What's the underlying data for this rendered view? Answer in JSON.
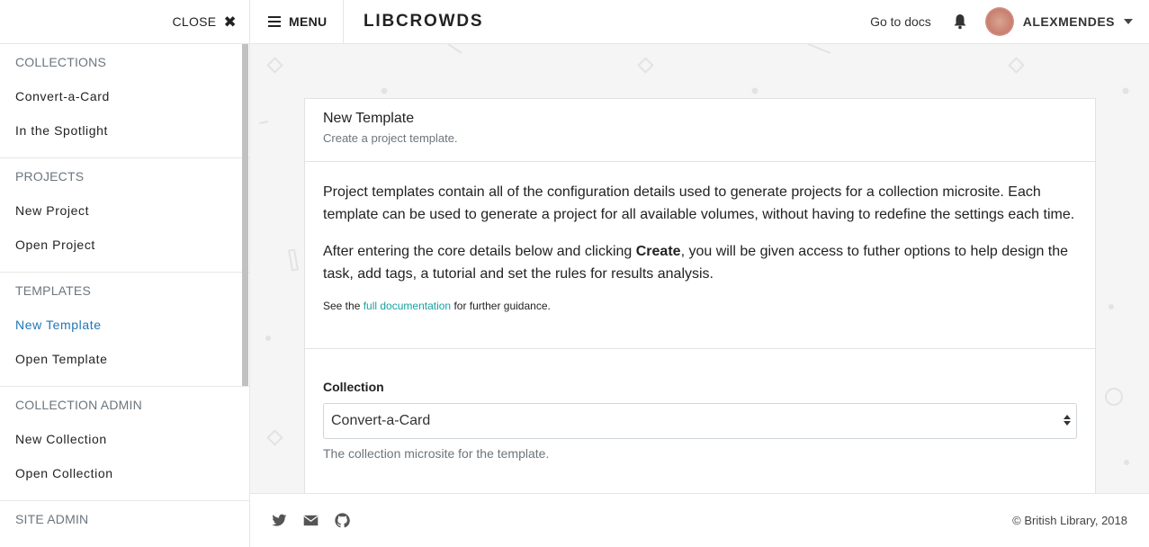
{
  "sidebar": {
    "close_label": "CLOSE",
    "sections": [
      {
        "title": "COLLECTIONS",
        "items": [
          "Convert-a-Card",
          "In the Spotlight"
        ]
      },
      {
        "title": "PROJECTS",
        "items": [
          "New Project",
          "Open Project"
        ]
      },
      {
        "title": "TEMPLATES",
        "items": [
          "New Template",
          "Open Template"
        ],
        "active": "New Template"
      },
      {
        "title": "COLLECTION ADMIN",
        "items": [
          "New Collection",
          "Open Collection"
        ]
      },
      {
        "title": "SITE ADMIN",
        "items": []
      }
    ]
  },
  "navbar": {
    "menu_label": "MENU",
    "brand": "LIBCROWDS",
    "docs_label": "Go to docs",
    "username": "ALEXMENDES"
  },
  "card": {
    "title": "New Template",
    "subtitle": "Create a project template.",
    "paragraph1": "Project templates contain all of the configuration details used to generate projects for a collection microsite. Each template can be used to generate a project for all available volumes, without having to redefine the settings each time.",
    "paragraph2_before": "After entering the core details below and clicking ",
    "paragraph2_bold": "Create",
    "paragraph2_after": ", you will be given access to futher options to help design the task, add tags, a tutorial and set the rules for results analysis.",
    "guidance_before": "See the ",
    "guidance_link": "full documentation",
    "guidance_after": " for further guidance.",
    "collection_label": "Collection",
    "collection_value": "Convert-a-Card",
    "collection_help": "The collection microsite for the template."
  },
  "footer": {
    "copyright": "© British Library, 2018"
  },
  "colors": {
    "accent_link": "#17a2a0",
    "active_nav": "#1f77b4"
  }
}
